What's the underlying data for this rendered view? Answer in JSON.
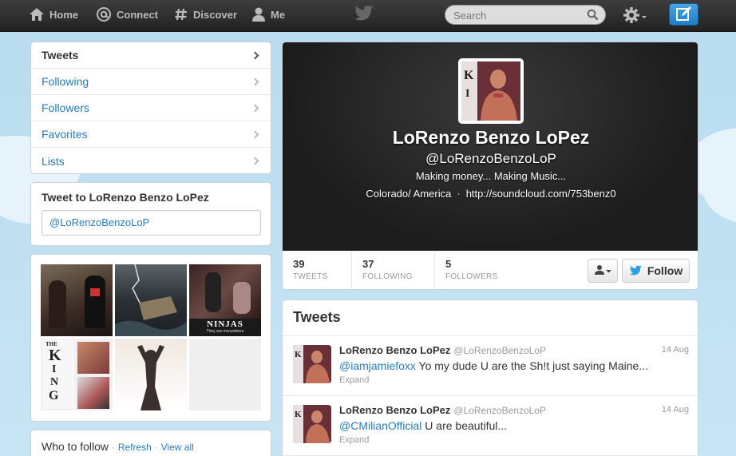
{
  "topbar": {
    "nav": [
      {
        "label": "Home",
        "icon": "home-icon"
      },
      {
        "label": "Connect",
        "icon": "at-icon"
      },
      {
        "label": "Discover",
        "icon": "hash-icon"
      },
      {
        "label": "Me",
        "icon": "person-icon"
      }
    ],
    "search_placeholder": "Search"
  },
  "sidebar": {
    "nav_items": [
      {
        "label": "Tweets",
        "active": true
      },
      {
        "label": "Following"
      },
      {
        "label": "Followers"
      },
      {
        "label": "Favorites"
      },
      {
        "label": "Lists"
      }
    ],
    "tweet_to": {
      "title": "Tweet to LoRenzo Benzo LoPez",
      "input_value": "@LoRenzoBenzoLoP"
    },
    "who_to_follow": {
      "title": "Who to follow",
      "refresh": "Refresh",
      "view_all": "View all",
      "dot": "·"
    }
  },
  "profile": {
    "name": "LoRenzo Benzo LoPez",
    "handle": "@LoRenzoBenzoLoP",
    "bio": "Making money... Making Music...",
    "location": "Colorado/ America",
    "separator": "·",
    "url": "http://soundcloud.com/753benz0",
    "stats": [
      {
        "num": "39",
        "label": "TWEETS"
      },
      {
        "num": "37",
        "label": "FOLLOWING"
      },
      {
        "num": "5",
        "label": "FOLLOWERS"
      }
    ],
    "follow_label": "Follow"
  },
  "tweets": {
    "title": "Tweets",
    "items": [
      {
        "name": "LoRenzo Benzo LoPez",
        "handle": "@LoRenzoBenzoLoP",
        "date": "14 Aug",
        "mention": "@iamjamiefoxx",
        "text": " Yo my dude U are the Sh!t just saying Maine...",
        "expand": "Expand"
      },
      {
        "name": "LoRenzo Benzo LoPez",
        "handle": "@LoRenzoBenzoLoP",
        "date": "14 Aug",
        "mention": "@CMilianOfficial",
        "text": " U are beautiful...",
        "expand": "Expand"
      }
    ]
  },
  "media_thumbs": {
    "ninjas_title": "NINJAS",
    "ninjas_sub": "They are everywhere",
    "logo_letters": [
      "THE",
      "K",
      "I",
      "N",
      "G"
    ]
  },
  "colors": {
    "link": "#2b7bb9",
    "topbar": "#2d2d2d",
    "accent": "#1f7fc7"
  }
}
